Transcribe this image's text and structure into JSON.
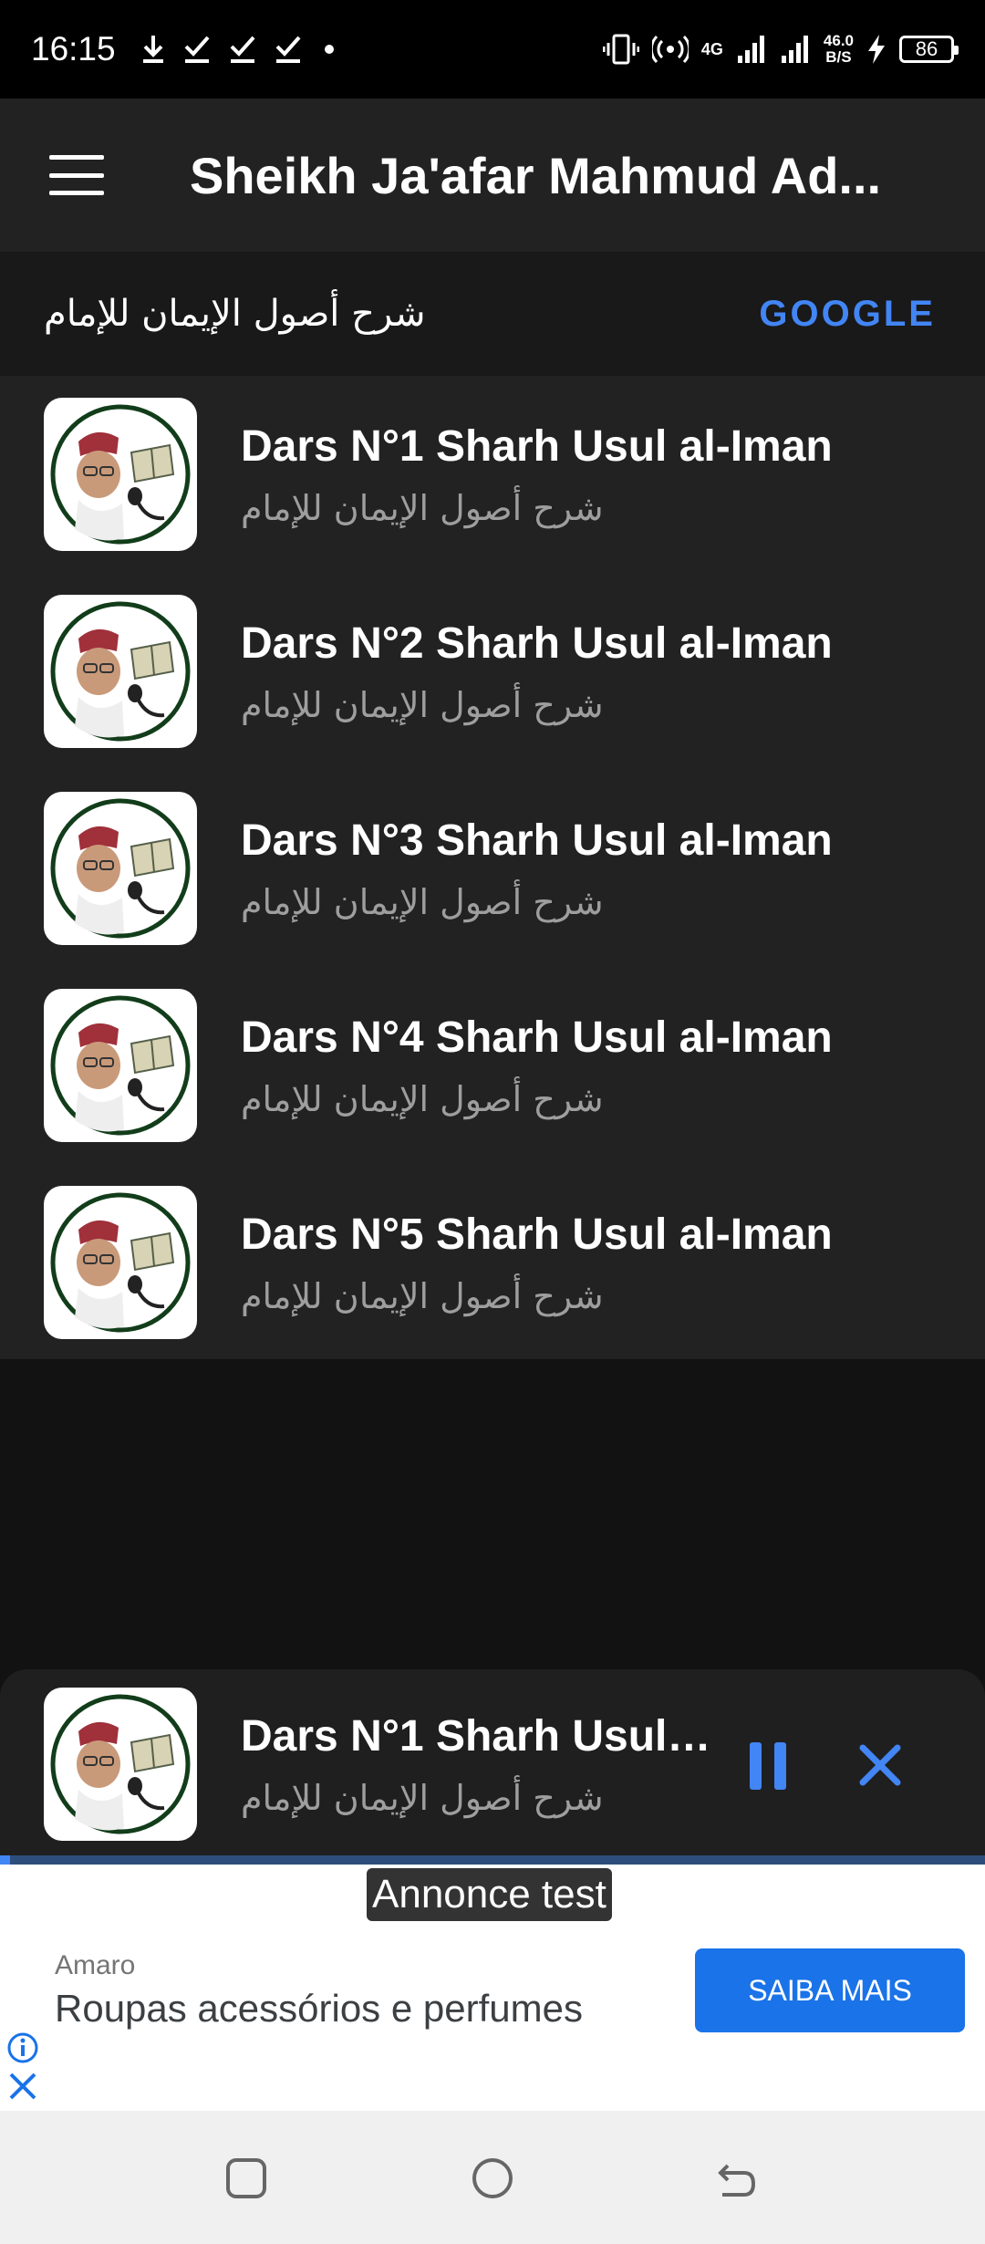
{
  "status_bar": {
    "time": "16:15",
    "network": "4G",
    "net_speed_value": "46.0",
    "net_speed_unit": "B/S",
    "battery": "86"
  },
  "app_bar": {
    "title": "Sheikh Ja'afar Mahmud Ad..."
  },
  "subheader": {
    "title": "شرح أصول الإيمان للإمام",
    "action": "GOOGLE"
  },
  "tracks": [
    {
      "title": "Dars N°1 Sharh Usul al-Iman",
      "subtitle": "شرح أصول الإيمان للإمام"
    },
    {
      "title": "Dars N°2 Sharh Usul al-Iman",
      "subtitle": "شرح أصول الإيمان للإمام"
    },
    {
      "title": "Dars N°3 Sharh Usul al-Iman",
      "subtitle": "شرح أصول الإيمان للإمام"
    },
    {
      "title": "Dars N°4 Sharh Usul al-Iman",
      "subtitle": "شرح أصول الإيمان للإمام"
    },
    {
      "title": "Dars N°5 Sharh Usul al-Iman",
      "subtitle": "شرح أصول الإيمان للإمام"
    }
  ],
  "player": {
    "title": "Dars N°1 Sharh Usul a...",
    "subtitle": "شرح أصول الإيمان للإمام",
    "progress": 0.01
  },
  "ad": {
    "test_label": "Annonce test",
    "advertiser": "Amaro",
    "headline": "Roupas acessórios e perfumes",
    "cta": "SAIBA MAIS"
  },
  "colors": {
    "accent": "#4285f4",
    "app_bar": "#222222",
    "background": "#121212",
    "ad_button": "#1a73e8"
  },
  "icons": [
    "download-icon",
    "check-icon",
    "vibrate-icon",
    "hotspot-icon",
    "signal-icon",
    "charging-icon",
    "menu-icon",
    "pause-icon",
    "close-icon",
    "info-icon",
    "recent-apps-icon",
    "home-icon",
    "back-icon"
  ]
}
